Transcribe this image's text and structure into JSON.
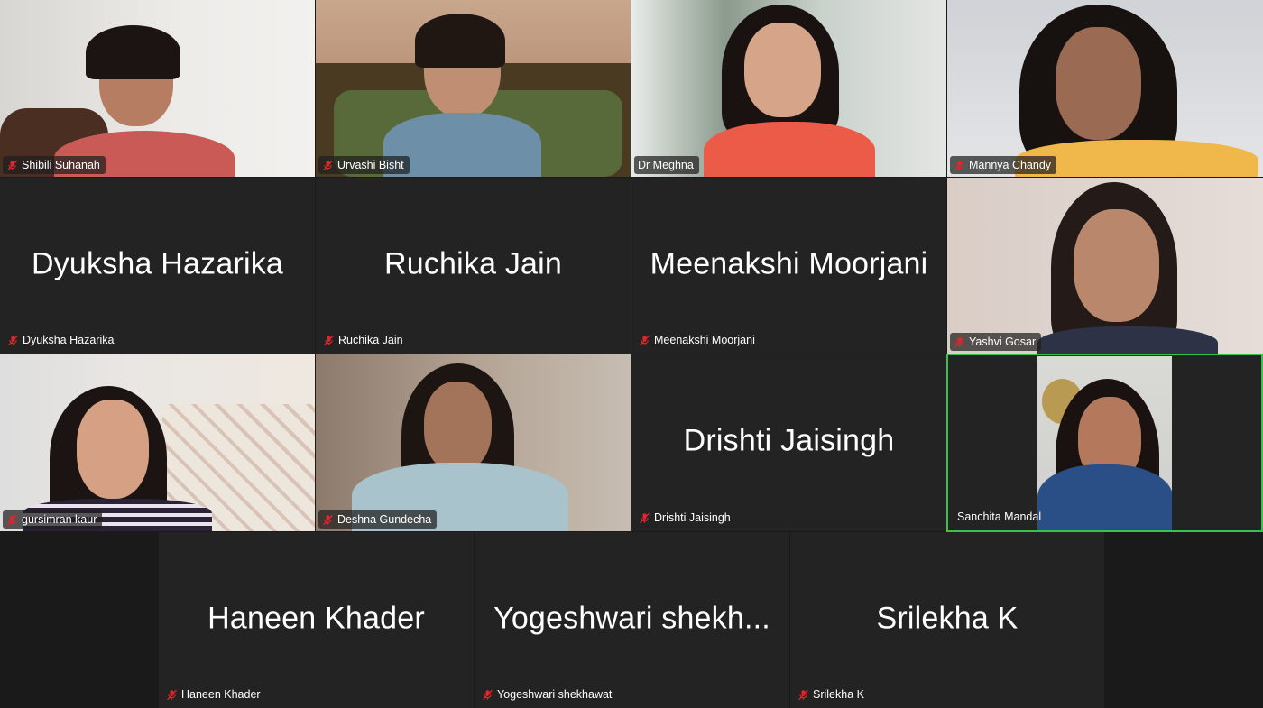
{
  "participants": {
    "p1": {
      "name": "Shibili Suhanah"
    },
    "p2": {
      "name": "Urvashi Bisht"
    },
    "p3": {
      "name": "Dr Meghna"
    },
    "p4": {
      "name": "Mannya Chandy"
    },
    "p5": {
      "name": "Dyuksha Hazarika",
      "display": "Dyuksha Hazarika"
    },
    "p6": {
      "name": "Ruchika Jain",
      "display": "Ruchika Jain"
    },
    "p7": {
      "name": "Meenakshi Moorjani",
      "display": "Meenakshi Moorjani"
    },
    "p8": {
      "name": "Yashvi Gosar"
    },
    "p9": {
      "name": "gursimran kaur"
    },
    "p10": {
      "name": "Deshna Gundecha"
    },
    "p11": {
      "name": "Drishti Jaisingh",
      "display": "Drishti Jaisingh"
    },
    "p12": {
      "name": "Sanchita Mandal"
    },
    "p13": {
      "name": "Haneen Khader",
      "display": "Haneen Khader"
    },
    "p14": {
      "name": "Yogeshwari shekhawat",
      "display": "Yogeshwari shekh..."
    },
    "p15": {
      "name": "Srilekha K",
      "display": "Srilekha K"
    }
  },
  "icons": {
    "muted": "mic-muted-icon"
  },
  "colors": {
    "active_speaker_border": "#39c24a",
    "muted_icon": "#e0262a",
    "tile_bg": "#232323"
  }
}
